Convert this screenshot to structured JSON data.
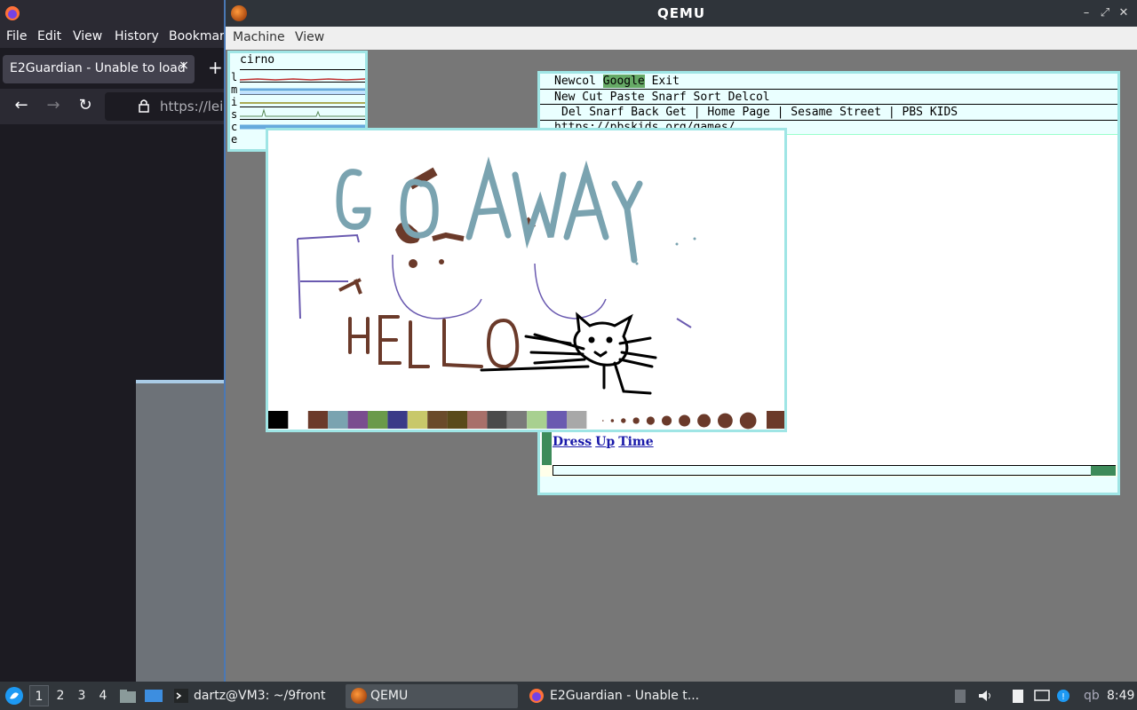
{
  "firefox": {
    "menu": [
      "File",
      "Edit",
      "View",
      "History",
      "Bookmarks"
    ],
    "tab_title": "E2Guardian - Unable to load",
    "tab_close": "×",
    "new_tab": "+",
    "url_text": "https://leig"
  },
  "qemu": {
    "title": "QEMU",
    "menu": [
      "Machine",
      "View"
    ]
  },
  "stats": {
    "hostname": "cirno",
    "labels": [
      "l",
      "m",
      "i",
      "s",
      "c",
      "e"
    ]
  },
  "acme": {
    "tag1": {
      "before": "Newcol ",
      "highlight": "Google",
      "after": " Exit"
    },
    "tag2": "New Cut Paste Snarf Sort Delcol",
    "tag3": "Del Snarf Back Get | Home Page | Sesame Street | PBS KIDS",
    "tag4": "https://pbskids.org/games/",
    "links": [
      "Dress",
      "Up",
      "Time"
    ]
  },
  "paint": {
    "drawn_text": [
      "GO AWAY",
      "HELLO"
    ],
    "palette": [
      "#000000",
      "#ffffff",
      "#6b3a2a",
      "#7aa3b0",
      "#7a4d8f",
      "#6a9a4a",
      "#3a3a88",
      "#c8c86a",
      "#6a4a2a",
      "#5a4a1a",
      "#a8706a",
      "#4a4a4a",
      "#7a7a7a",
      "#a8d090",
      "#6a5ab0",
      "#a8a8a8"
    ],
    "brush_sizes": [
      1,
      2,
      3,
      4,
      5,
      6,
      7,
      8,
      9,
      10
    ],
    "current_color": "#6b3a2a"
  },
  "taskbar": {
    "desktops": [
      "1",
      "2",
      "3",
      "4"
    ],
    "terminal": "dartz@VM3: ~/9front",
    "qemu": "QEMU",
    "firefox": "E2Guardian - Unable t...",
    "tray_label": "qb",
    "clock": "8:49"
  }
}
